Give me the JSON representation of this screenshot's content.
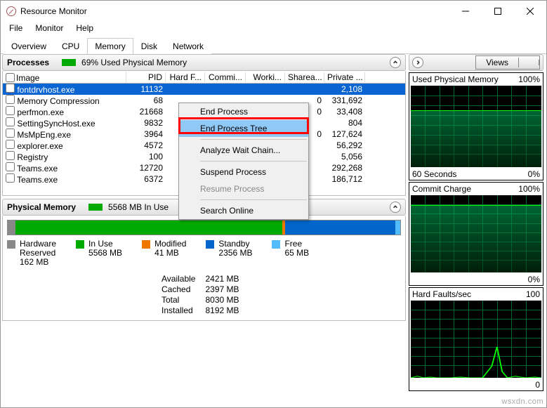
{
  "window": {
    "title": "Resource Monitor"
  },
  "menu": {
    "file": "File",
    "monitor": "Monitor",
    "help": "Help"
  },
  "tabs": {
    "overview": "Overview",
    "cpu": "CPU",
    "memory": "Memory",
    "disk": "Disk",
    "network": "Network"
  },
  "processes_panel": {
    "title": "Processes",
    "stat": "69% Used Physical Memory",
    "cols": {
      "image": "Image",
      "pid": "PID",
      "hardf": "Hard F...",
      "commit": "Commi...",
      "working": "Worki...",
      "sharea": "Sharea...",
      "private": "Private ..."
    },
    "rows": [
      {
        "image": "fontdrvhost.exe",
        "pid": "11132",
        "private": "2,108",
        "sel": true
      },
      {
        "image": "Memory Compression",
        "pid": "68",
        "sharea": "0",
        "private": "331,692"
      },
      {
        "image": "perfmon.exe",
        "pid": "21668",
        "sharea": "0",
        "private": "33,408"
      },
      {
        "image": "SettingSyncHost.exe",
        "pid": "9832",
        "private": "804"
      },
      {
        "image": "MsMpEng.exe",
        "pid": "3964",
        "sharea": "0",
        "private": "127,624"
      },
      {
        "image": "explorer.exe",
        "pid": "4572",
        "private": "56,292"
      },
      {
        "image": "Registry",
        "pid": "100",
        "private": "5,056"
      },
      {
        "image": "Teams.exe",
        "pid": "12720",
        "private": "292,268"
      },
      {
        "image": "Teams.exe",
        "pid": "6372",
        "private": "186,712"
      }
    ]
  },
  "context_menu": {
    "end_process": "End Process",
    "end_process_tree": "End Process Tree",
    "analyze": "Analyze Wait Chain...",
    "suspend": "Suspend Process",
    "resume": "Resume Process",
    "search": "Search Online"
  },
  "physical_panel": {
    "title": "Physical Memory",
    "in_use_label": "5568 MB In Use",
    "available_label": "2421 MB Available",
    "legend": {
      "hw": "Hardware",
      "hw2": "Reserved",
      "hw3": "162 MB",
      "inuse": "In Use",
      "inuse2": "5568 MB",
      "mod": "Modified",
      "mod2": "41 MB",
      "standby": "Standby",
      "standby2": "2356 MB",
      "free": "Free",
      "free2": "65 MB"
    },
    "stats": {
      "l1": "Available",
      "v1": "2421 MB",
      "l2": "Cached",
      "v2": "2397 MB",
      "l3": "Total",
      "v3": "8030 MB",
      "l4": "Installed",
      "v4": "8192 MB"
    }
  },
  "right": {
    "views": "Views",
    "g1": {
      "title": "Used Physical Memory",
      "val": "100%",
      "bl": "60 Seconds",
      "br": "0%"
    },
    "g2": {
      "title": "Commit Charge",
      "val": "100%",
      "br": "0%"
    },
    "g3": {
      "title": "Hard Faults/sec",
      "val": "100",
      "br": "0"
    }
  },
  "watermark": "wsxdn.com"
}
